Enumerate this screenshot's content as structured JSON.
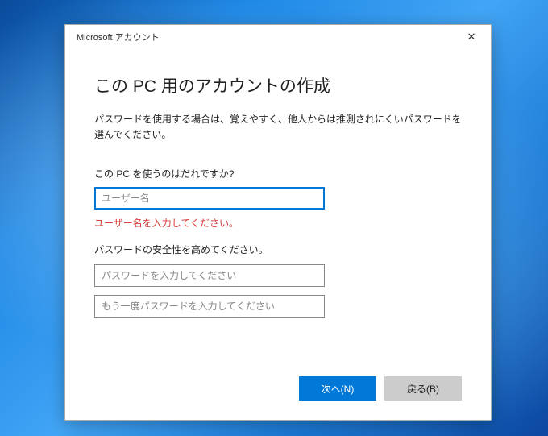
{
  "titlebar": {
    "title": "Microsoft アカウント"
  },
  "heading": "この PC 用のアカウントの作成",
  "description": "パスワードを使用する場合は、覚えやすく、他人からは推測されにくいパスワードを選んでください。",
  "username_section": {
    "label": "この PC を使うのはだれですか?",
    "placeholder": "ユーザー名",
    "error": "ユーザー名を入力してください。"
  },
  "password_section": {
    "label": "パスワードの安全性を高めてください。",
    "password_placeholder": "パスワードを入力してください",
    "confirm_placeholder": "もう一度パスワードを入力してください"
  },
  "buttons": {
    "next": "次へ(N)",
    "back": "戻る(B)"
  }
}
